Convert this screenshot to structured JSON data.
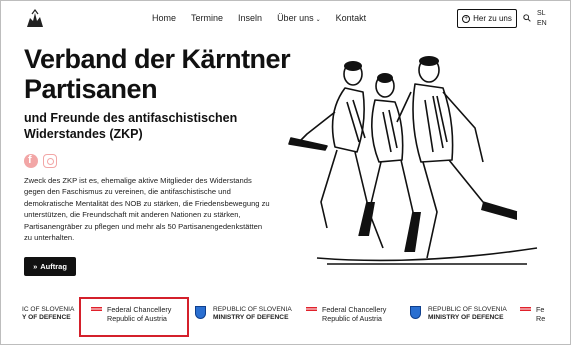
{
  "nav": {
    "items": [
      "Home",
      "Termine",
      "Inseln",
      "Über uns",
      "Kontakt"
    ],
    "cta_label": "Her zu uns",
    "languages": [
      "SL",
      "EN"
    ]
  },
  "hero": {
    "title": "Verband der Kärntner Partisanen",
    "subtitle": "und Freunde des antifaschistischen Widerstandes (ZKP)",
    "description": "Zweck des ZKP ist es, ehemalige aktive Mitglieder des Widerstands gegen den Faschismus zu vereinen, die antifaschistische und demokratische Mentalität des NOB zu stärken, die Friedensbewegung zu unterstützen, die Freundschaft mit anderen Nationen zu stärken, Partisanengräber zu pflegen und mehr als 50 Partisanengedenkstätten zu unterhalten.",
    "button_label": "Auftrag"
  },
  "logos": {
    "slo_partial_line1": "IC OF SLOVENIA",
    "slo_partial_line2": "Y OF DEFENCE",
    "aut_line1": "Federal Chancellery",
    "aut_line2": "Republic of Austria",
    "slo_line1": "REPUBLIC OF SLOVENIA",
    "slo_line2": "MINISTRY OF DEFENCE",
    "aut_partial_line1": "Fe",
    "aut_partial_line2": "Re"
  },
  "colors": {
    "accent": "#111111",
    "highlight": "#d4202b",
    "social": "#f2a6a6"
  },
  "icons": [
    "logo-icon",
    "chevron-down-icon",
    "user-circle-icon",
    "search-icon",
    "facebook-icon",
    "instagram-icon",
    "double-chevron-icon",
    "austria-flag-icon",
    "slovenia-shield-icon"
  ]
}
